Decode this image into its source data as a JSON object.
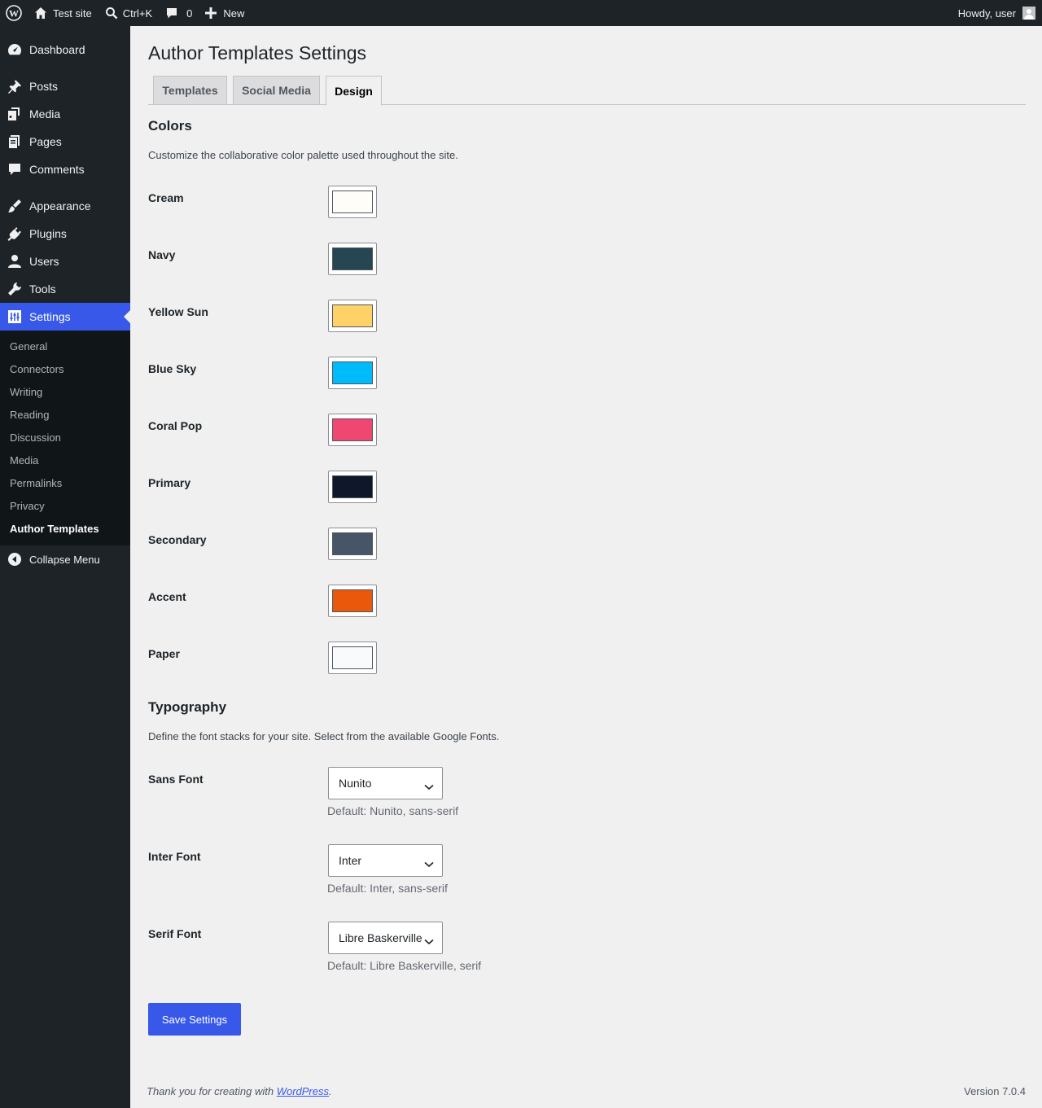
{
  "admin_bar": {
    "site_name": "Test site",
    "search_shortcut": "Ctrl+K",
    "comments_count": "0",
    "new_label": "New",
    "greeting": "Howdy, user"
  },
  "sidebar": {
    "items": [
      {
        "label": "Dashboard",
        "icon": "dashboard-icon"
      },
      {
        "label": "Posts",
        "icon": "pin-icon"
      },
      {
        "label": "Media",
        "icon": "media-icon"
      },
      {
        "label": "Pages",
        "icon": "pages-icon"
      },
      {
        "label": "Comments",
        "icon": "comments-icon"
      },
      {
        "label": "Appearance",
        "icon": "brush-icon"
      },
      {
        "label": "Plugins",
        "icon": "plugin-icon"
      },
      {
        "label": "Users",
        "icon": "users-icon"
      },
      {
        "label": "Tools",
        "icon": "wrench-icon"
      },
      {
        "label": "Settings",
        "icon": "settings-icon"
      }
    ],
    "submenu": [
      "General",
      "Connectors",
      "Writing",
      "Reading",
      "Discussion",
      "Media",
      "Permalinks",
      "Privacy",
      "Author Templates"
    ],
    "collapse_label": "Collapse Menu",
    "current_color": "#3858e9"
  },
  "page": {
    "title": "Author Templates Settings",
    "tabs": [
      "Templates",
      "Social Media",
      "Design"
    ],
    "active_tab": "Design"
  },
  "colors": {
    "heading": "Colors",
    "description": "Customize the collaborative color palette used throughout the site.",
    "items": [
      {
        "label": "Cream",
        "value": "#fffdf7"
      },
      {
        "label": "Navy",
        "value": "#264653"
      },
      {
        "label": "Yellow Sun",
        "value": "#ffd166"
      },
      {
        "label": "Blue Sky",
        "value": "#00bbf9"
      },
      {
        "label": "Coral Pop",
        "value": "#ef476f"
      },
      {
        "label": "Primary",
        "value": "#0f172a"
      },
      {
        "label": "Secondary",
        "value": "#475569"
      },
      {
        "label": "Accent",
        "value": "#ea580c"
      },
      {
        "label": "Paper",
        "value": "#f8fafc"
      }
    ]
  },
  "typography": {
    "heading": "Typography",
    "description": "Define the font stacks for your site. Select from the available Google Fonts.",
    "items": [
      {
        "label": "Sans Font",
        "value": "Nunito",
        "help": "Default: Nunito, sans-serif"
      },
      {
        "label": "Inter Font",
        "value": "Inter",
        "help": "Default: Inter, sans-serif"
      },
      {
        "label": "Serif Font",
        "value": "Libre Baskerville",
        "help": "Default: Libre Baskerville, serif"
      }
    ]
  },
  "save_label": "Save Settings",
  "footer": {
    "thanks_prefix": "Thank you for creating with ",
    "thanks_link": "WordPress",
    "thanks_suffix": ".",
    "version": "Version 7.0.4"
  }
}
